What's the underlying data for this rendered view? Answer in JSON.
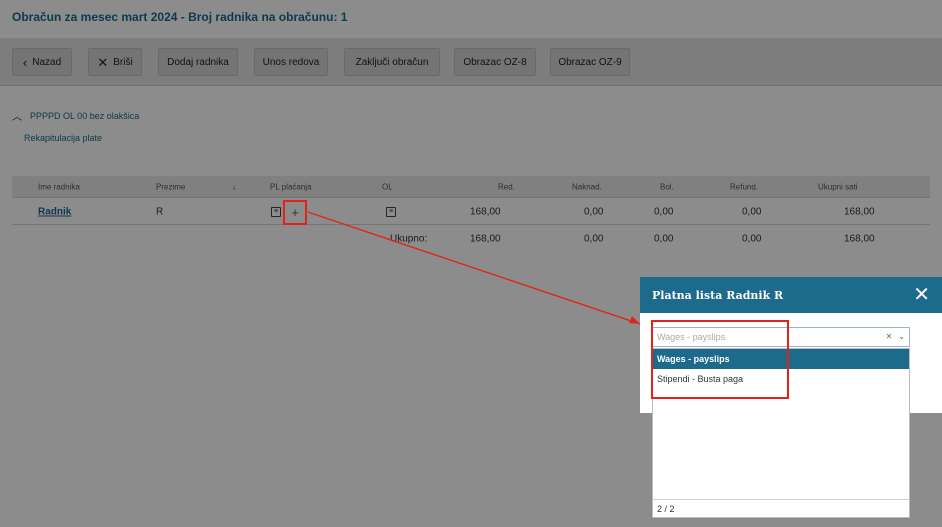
{
  "page": {
    "title": "Obračun za mesec mart 2024 - Broj radnika na obračunu: 1"
  },
  "toolbar": {
    "back": "Nazad",
    "delete": "Briši",
    "add_employee": "Dodaj radnika",
    "enter_rows": "Unos redova",
    "close_calc": "Zaključi obračun",
    "form_oz8": "Obrazac OZ-8",
    "form_oz9": "Obrazac OZ-9"
  },
  "section": {
    "group_label": "PPPPD OL 00 bez olakšica",
    "recap_link": "Rekapitulacija plate"
  },
  "table": {
    "headers": [
      "Ime radnika",
      "Prezime",
      "↓",
      "PL plaćanja",
      "OL",
      "Red.",
      "Naknad.",
      "Bol.",
      "Refund.",
      "Ukupni sati"
    ],
    "row": {
      "name": "Radnik",
      "surname": "R",
      "red": "168,00",
      "naknad": "0,00",
      "bol": "0,00",
      "refund": "0,00",
      "ukupni": "168,00"
    },
    "total": {
      "label": "Ukupno:",
      "red": "168,00",
      "naknad": "0,00",
      "bol": "0,00",
      "refund": "0,00",
      "ukupni": "168,00"
    }
  },
  "modal": {
    "title": "Platna lista Radnik R",
    "select_placeholder": "Wages - payslips",
    "options": [
      "Wages - payslips",
      "Stipendi - Busta paga"
    ],
    "footer": "2 / 2"
  },
  "colors": {
    "accent": "#1c6a8c",
    "highlight_red": "#e0241c"
  },
  "icons": {
    "back": "chevron-left-icon",
    "delete": "x-icon",
    "document": "document-icon",
    "add": "plus-icon",
    "collapse": "chevron-up-icon",
    "close": "close-icon",
    "clear": "x-icon",
    "dropdown": "chevron-down-icon"
  }
}
